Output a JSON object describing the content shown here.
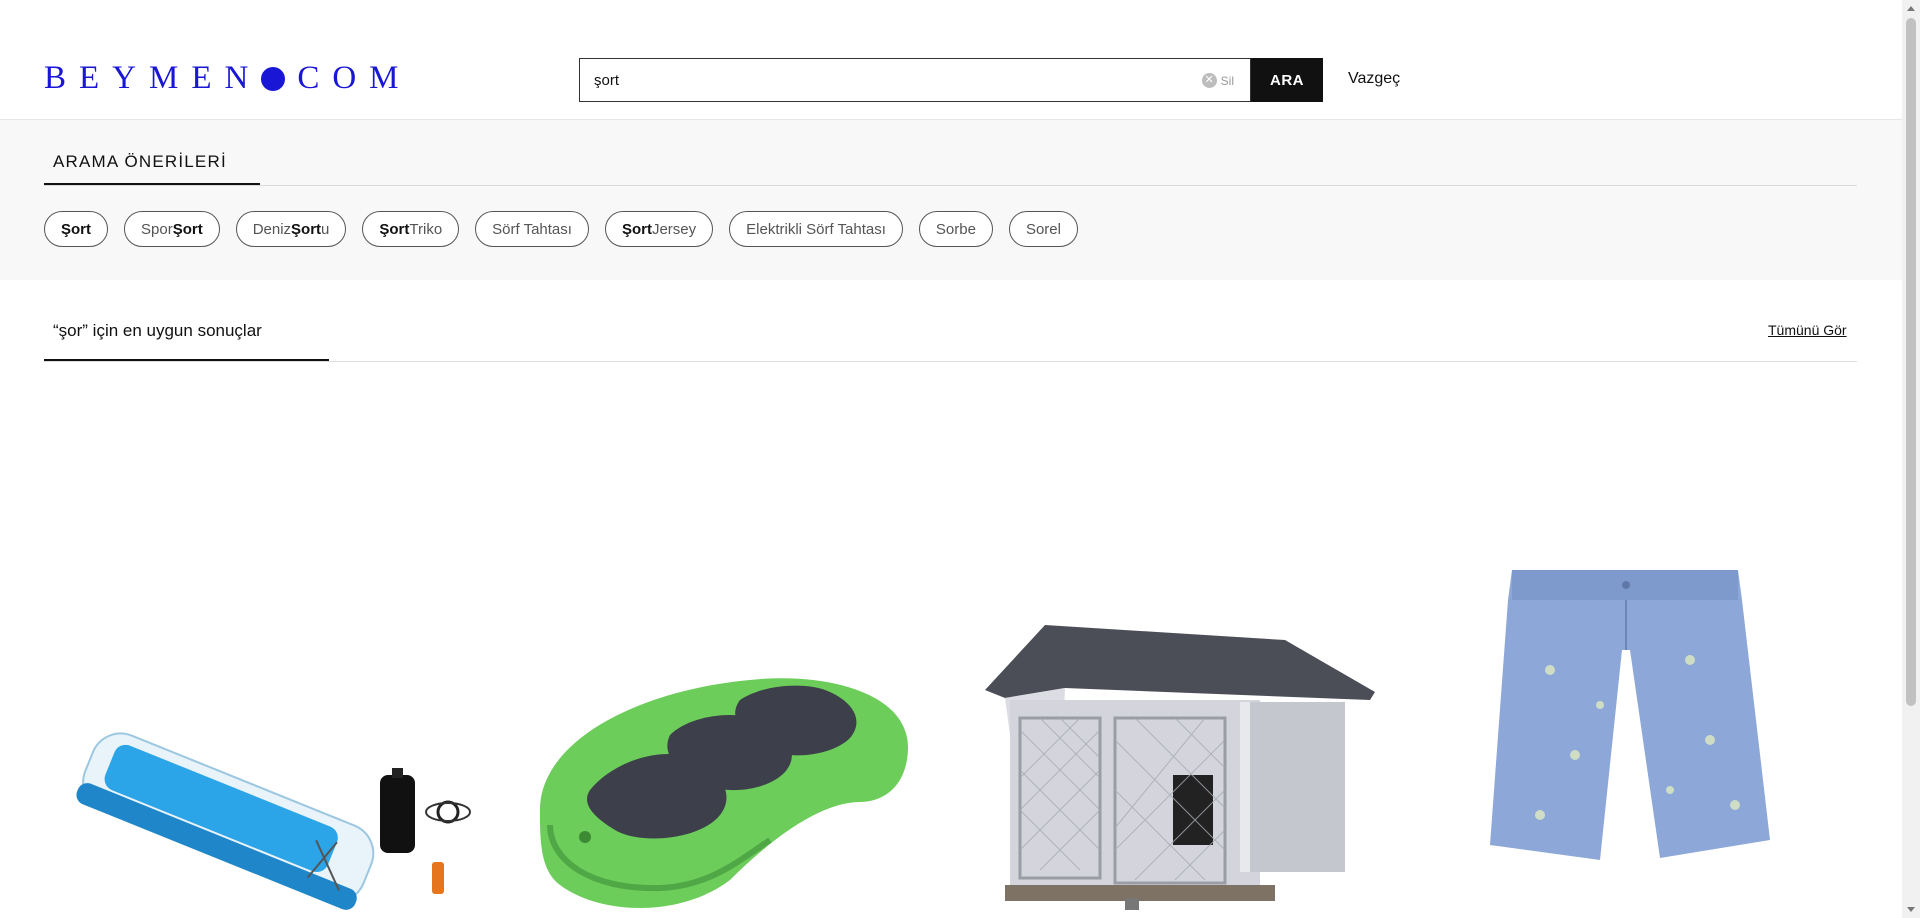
{
  "header": {
    "logo_text_left": "BEYMEN",
    "logo_text_right": "COM",
    "search_value": "şort",
    "clear_label": "Sil",
    "search_button": "ARA",
    "cancel_label": "Vazgeç"
  },
  "suggestions": {
    "title": "ARAMA ÖNERİLERİ",
    "chips": [
      {
        "pre": "",
        "bold": "Şort",
        "post": ""
      },
      {
        "pre": "Spor ",
        "bold": "Şort",
        "post": ""
      },
      {
        "pre": "Deniz ",
        "bold": "Şort",
        "post": "u"
      },
      {
        "pre": "",
        "bold": "Şort",
        "post": " Triko"
      },
      {
        "pre": "Sörf Tahtası",
        "bold": "",
        "post": ""
      },
      {
        "pre": "",
        "bold": "Şort",
        "post": " Jersey"
      },
      {
        "pre": "Elektrikli Sörf Tahtası",
        "bold": "",
        "post": ""
      },
      {
        "pre": "Sorbe",
        "bold": "",
        "post": ""
      },
      {
        "pre": "Sorel",
        "bold": "",
        "post": ""
      }
    ]
  },
  "results": {
    "title": "“şor” için en uygun sonuçlar",
    "see_all": "Tümünü Gör"
  },
  "products": [
    {
      "name": "inflatable-air-track-product"
    },
    {
      "name": "green-balance-board-product"
    },
    {
      "name": "dog-house-kennel-product"
    },
    {
      "name": "blue-polo-shorts-product"
    }
  ],
  "colors": {
    "brand": "#1a16d6",
    "button_bg": "#111111"
  }
}
